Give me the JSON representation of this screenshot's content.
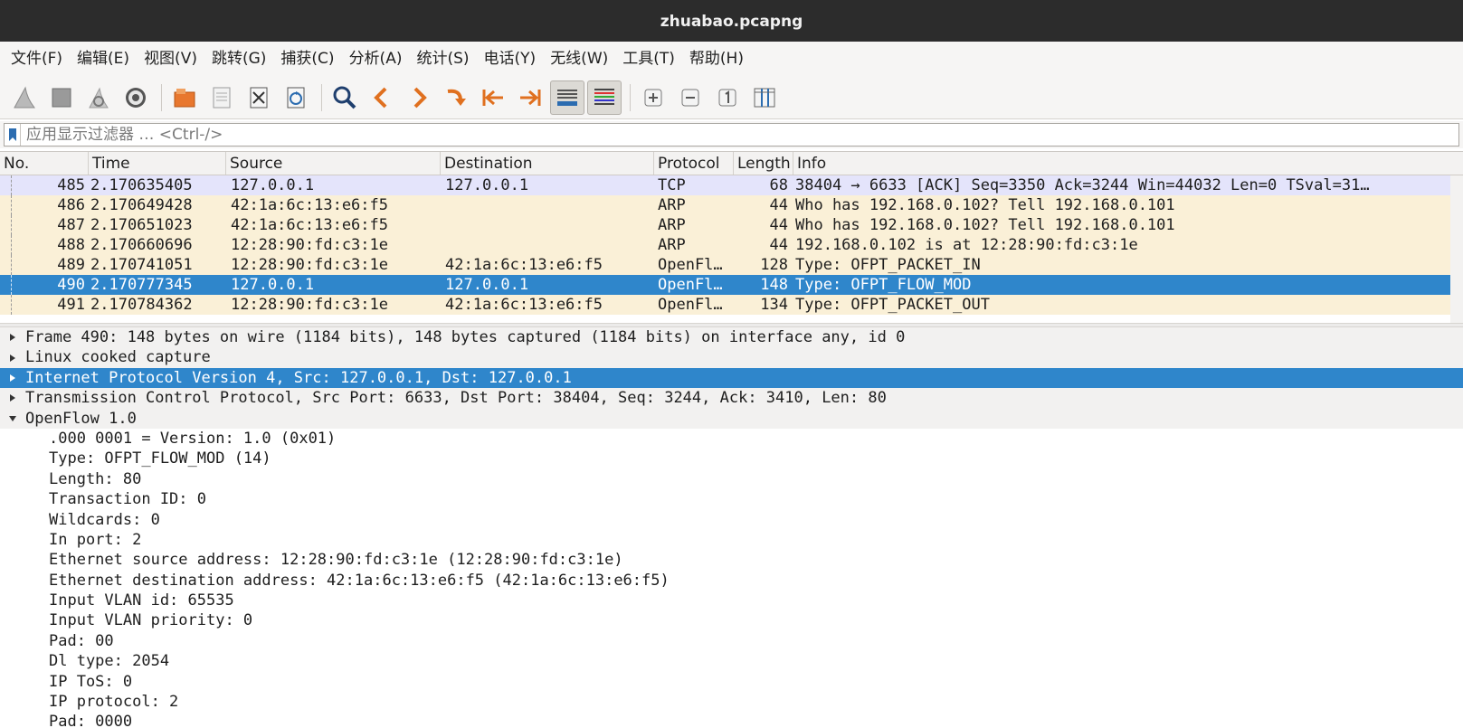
{
  "window": {
    "title": "zhuabao.pcapng"
  },
  "menu": [
    "文件(F)",
    "编辑(E)",
    "视图(V)",
    "跳转(G)",
    "捕获(C)",
    "分析(A)",
    "统计(S)",
    "电话(Y)",
    "无线(W)",
    "工具(T)",
    "帮助(H)"
  ],
  "filter": {
    "placeholder": "应用显示过滤器 … <Ctrl-/>"
  },
  "columns": {
    "no": "No.",
    "time": "Time",
    "source": "Source",
    "destination": "Destination",
    "protocol": "Protocol",
    "length": "Length",
    "info": "Info"
  },
  "packets": [
    {
      "no": "485",
      "time": "2.170635405",
      "source": "127.0.0.1",
      "destination": "127.0.0.1",
      "protocol": "TCP",
      "length": "68",
      "info": "38404 → 6633 [ACK] Seq=3350 Ack=3244 Win=44032 Len=0 TSval=31…"
    },
    {
      "no": "486",
      "time": "2.170649428",
      "source": "42:1a:6c:13:e6:f5",
      "destination": "",
      "protocol": "ARP",
      "length": "44",
      "info": "Who has 192.168.0.102? Tell 192.168.0.101"
    },
    {
      "no": "487",
      "time": "2.170651023",
      "source": "42:1a:6c:13:e6:f5",
      "destination": "",
      "protocol": "ARP",
      "length": "44",
      "info": "Who has 192.168.0.102? Tell 192.168.0.101"
    },
    {
      "no": "488",
      "time": "2.170660696",
      "source": "12:28:90:fd:c3:1e",
      "destination": "",
      "protocol": "ARP",
      "length": "44",
      "info": "192.168.0.102 is at 12:28:90:fd:c3:1e"
    },
    {
      "no": "489",
      "time": "2.170741051",
      "source": "12:28:90:fd:c3:1e",
      "destination": "42:1a:6c:13:e6:f5",
      "protocol": "OpenFl…",
      "length": "128",
      "info": "Type: OFPT_PACKET_IN"
    },
    {
      "no": "490",
      "time": "2.170777345",
      "source": "127.0.0.1",
      "destination": "127.0.0.1",
      "protocol": "OpenFl…",
      "length": "148",
      "info": "Type: OFPT_FLOW_MOD"
    },
    {
      "no": "491",
      "time": "2.170784362",
      "source": "12:28:90:fd:c3:1e",
      "destination": "42:1a:6c:13:e6:f5",
      "protocol": "OpenFl…",
      "length": "134",
      "info": "Type: OFPT_PACKET_OUT"
    }
  ],
  "selected_packet": "490",
  "details": {
    "tree": [
      "Frame 490: 148 bytes on wire (1184 bits), 148 bytes captured (1184 bits) on interface any, id 0",
      "Linux cooked capture",
      "Internet Protocol Version 4, Src: 127.0.0.1, Dst: 127.0.0.1",
      "Transmission Control Protocol, Src Port: 6633, Dst Port: 38404, Seq: 3244, Ack: 3410, Len: 80",
      "OpenFlow 1.0"
    ],
    "openflow_fields": [
      ".000 0001 = Version: 1.0 (0x01)",
      "Type: OFPT_FLOW_MOD (14)",
      "Length: 80",
      "Transaction ID: 0",
      "Wildcards: 0",
      "In port: 2",
      "Ethernet source address: 12:28:90:fd:c3:1e (12:28:90:fd:c3:1e)",
      "Ethernet destination address: 42:1a:6c:13:e6:f5 (42:1a:6c:13:e6:f5)",
      "Input VLAN id: 65535",
      "Input VLAN priority: 0",
      "Pad: 00",
      "Dl type: 2054",
      "IP ToS: 0",
      "IP protocol: 2",
      "Pad: 0000"
    ]
  },
  "colors": {
    "selection": "#2f86cb",
    "tcp_row": "#e4e4fb",
    "arp_row": "#faf0d7",
    "titlebar": "#2c2c2c"
  }
}
